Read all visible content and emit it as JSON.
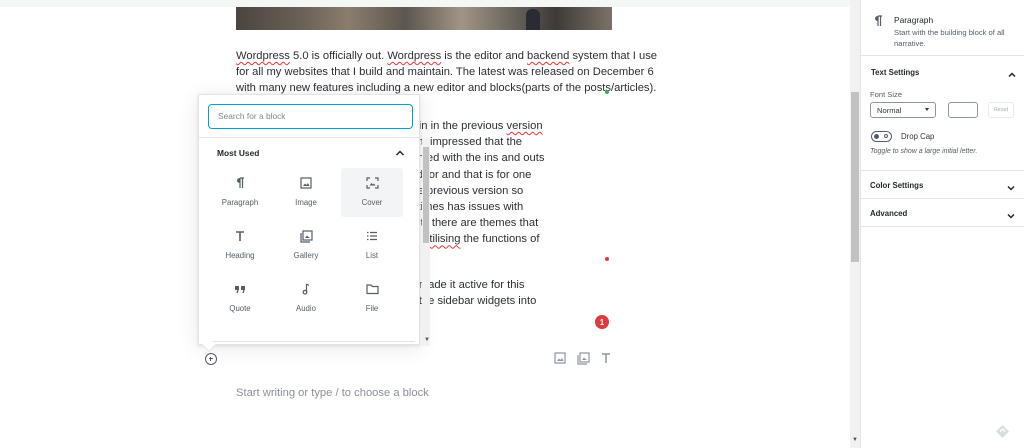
{
  "editor": {
    "paragraph1": {
      "lines": [
        {
          "parts": [
            {
              "t": "Wordpress",
              "spell": true
            },
            {
              "t": " 5.0 is officially out. "
            },
            {
              "t": "Wordpress",
              "spell": true
            },
            {
              "t": " is the editor and "
            },
            {
              "t": "backend",
              "spell": true
            },
            {
              "t": " system that I use"
            }
          ]
        },
        {
          "parts": [
            {
              "t": "for all my websites that I build and maintain. The latest was released on December 6"
            }
          ]
        },
        {
          "parts": [
            {
              "t": "with many new features including a new editor and blocks(parts of the posts/articles)."
            }
          ]
        }
      ]
    },
    "paragraph2": {
      "lines": [
        {
          "parts": [
            {
              "t": "                                  Gutenberg plugin in the previous "
            },
            {
              "t": "version",
              "spell": true
            }
          ]
        },
        {
          "parts": [
            {
              "t": "                                  would bring. I am impressed that the"
            }
          ]
        },
        {
          "parts": [
            {
              "t": "                                  become acquainted with the ins and outs"
            }
          ]
        },
        {
          "parts": [
            {
              "t": "                                  tick to the old editor and that is for one"
            }
          ]
        },
        {
          "parts": [
            {
              "t": "                                  "
            },
            {
              "t": "ustomised",
              "spell": true
            },
            {
              "t": " to the previous version so"
            }
          ]
        },
        {
          "parts": [
            {
              "t": "                                  y editor it sometimes has issues with"
            }
          ]
        },
        {
          "parts": [
            {
              "t": "                                  gers will wait until there are themes that"
            }
          ]
        },
        {
          "parts": [
            {
              "t": "                                  ss 5 before fully "
            },
            {
              "t": "utilising",
              "spell": true
            },
            {
              "t": " the functions of"
            }
          ]
        }
      ]
    },
    "paragraph3": {
      "lines": [
        {
          "parts": [
            {
              "t": "                                  hat I can see (I made it active for this"
            }
          ]
        },
        {
          "parts": [
            {
              "t": "                                  so it pushes all the sidebar widgets into"
            }
          ]
        }
      ]
    },
    "notification_count": "1",
    "placeholder": "Start writing or type / to choose a block"
  },
  "inserter": {
    "search_placeholder": "Search for a block",
    "section_title": "Most Used",
    "blocks": [
      {
        "label": "Paragraph",
        "icon": "paragraph-icon"
      },
      {
        "label": "Image",
        "icon": "image-icon"
      },
      {
        "label": "Cover",
        "icon": "cover-icon"
      },
      {
        "label": "Heading",
        "icon": "heading-icon"
      },
      {
        "label": "Gallery",
        "icon": "gallery-icon"
      },
      {
        "label": "List",
        "icon": "list-icon"
      },
      {
        "label": "Quote",
        "icon": "quote-icon"
      },
      {
        "label": "Audio",
        "icon": "audio-icon"
      },
      {
        "label": "File",
        "icon": "file-icon"
      }
    ]
  },
  "sidebar": {
    "block_title": "Paragraph",
    "block_description": "Start with the building block of all narrative.",
    "text_settings": {
      "title": "Text Settings",
      "font_size_label": "Font Size",
      "font_size_value": "Normal",
      "reset_label": "Reset",
      "drop_cap_label": "Drop Cap",
      "drop_cap_help": "Toggle to show a large initial letter."
    },
    "color_settings_title": "Color Settings",
    "advanced_title": "Advanced"
  },
  "colors": {
    "accent": "#00a0d2",
    "spell_error": "#e33333",
    "badge": "#e0393e",
    "green_dot": "#31b35a"
  }
}
